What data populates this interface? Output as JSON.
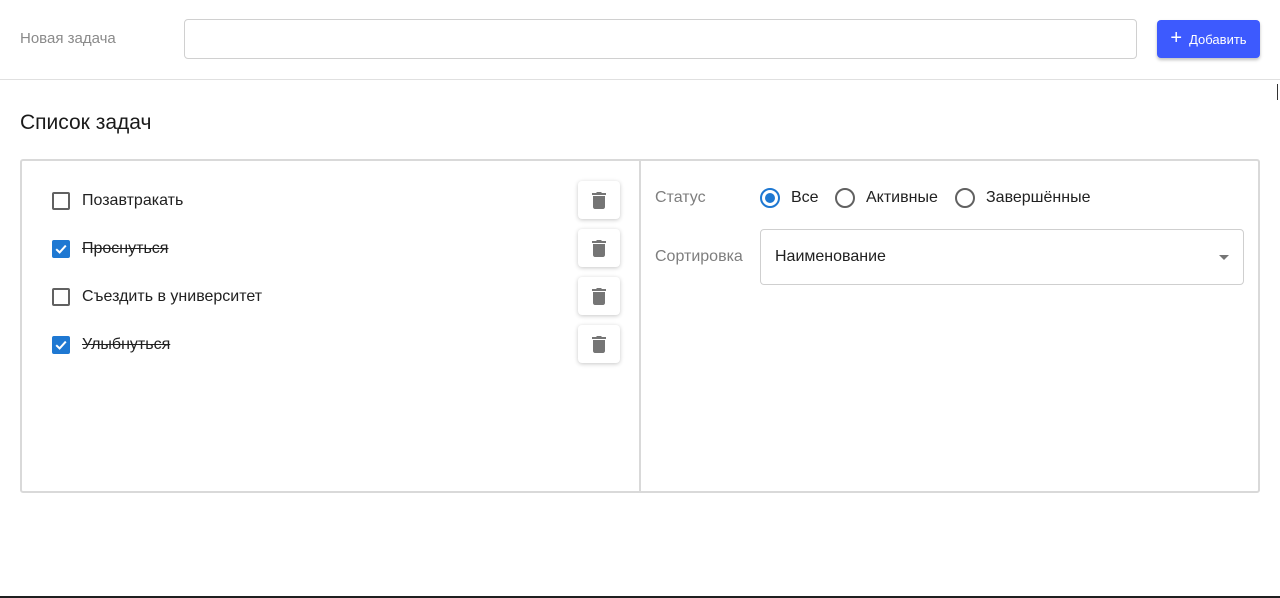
{
  "header": {
    "new_task_label": "Новая задача",
    "new_task_value": "",
    "new_task_placeholder": "",
    "add_button_label": "Добавить"
  },
  "list": {
    "title": "Список задач",
    "tasks": [
      {
        "label": "Позавтракать",
        "done": false
      },
      {
        "label": "Проснуться",
        "done": true
      },
      {
        "label": "Съездить в университет",
        "done": false
      },
      {
        "label": "Улыбнуться",
        "done": true
      }
    ]
  },
  "filters": {
    "status_label": "Статус",
    "status_options": [
      {
        "label": "Все",
        "selected": true
      },
      {
        "label": "Активные",
        "selected": false
      },
      {
        "label": "Завершённые",
        "selected": false
      }
    ],
    "sort_label": "Сортировка",
    "sort_value": "Наименование"
  },
  "colors": {
    "accent": "#3d5afe",
    "checkbox_checked": "#1e78d2",
    "icon_gray": "#757575"
  },
  "icons": {
    "add": "plus-icon",
    "delete": "trash-icon",
    "check": "check-icon",
    "dropdown": "arrow-drop-down-icon"
  }
}
